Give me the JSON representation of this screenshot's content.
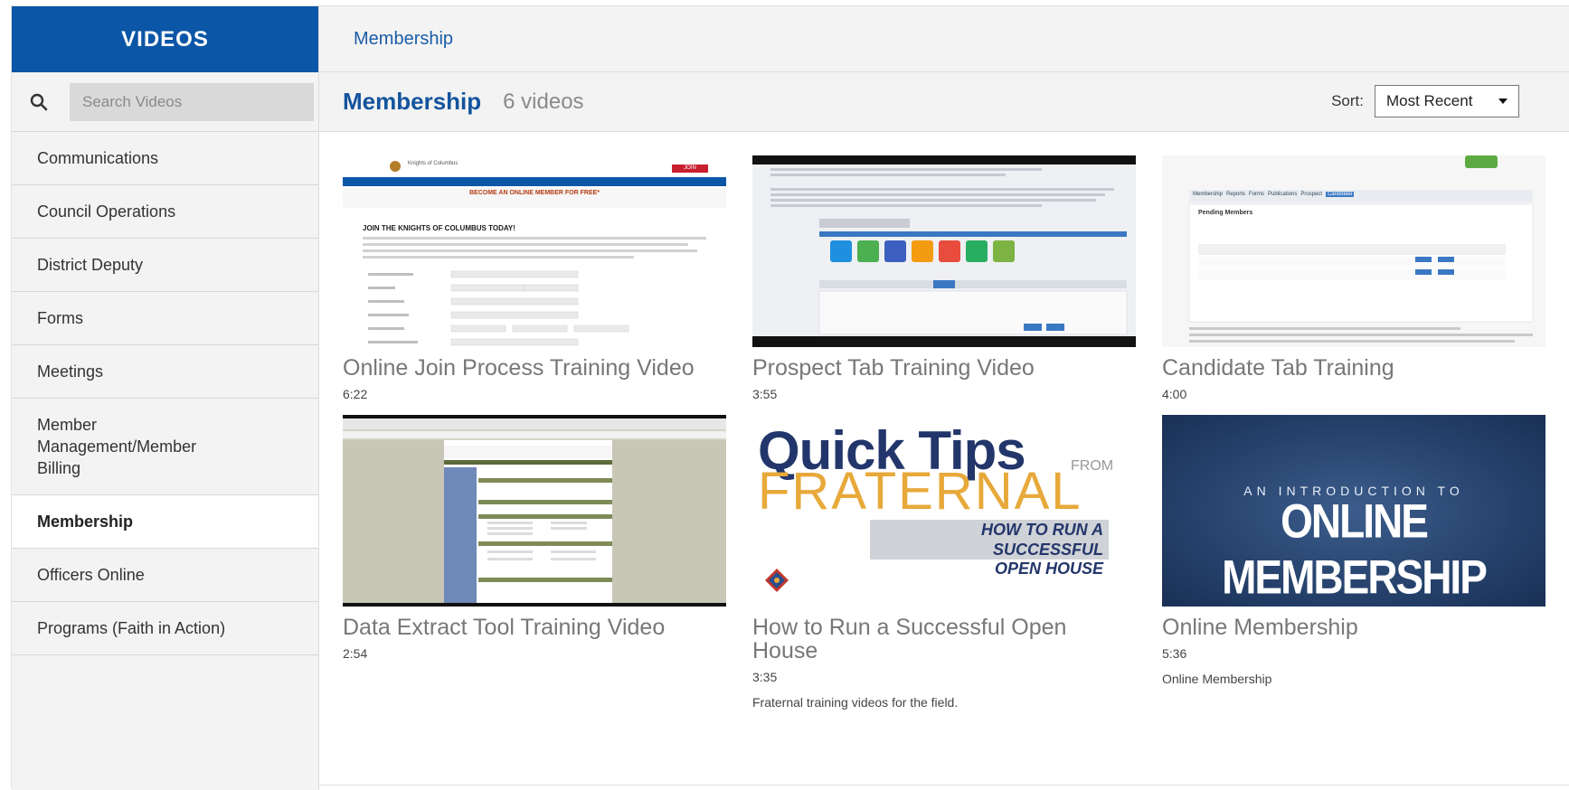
{
  "sidebar": {
    "title": "VIDEOS",
    "search_placeholder": "Search Videos",
    "categories": [
      {
        "label": "Communications"
      },
      {
        "label": "Council Operations"
      },
      {
        "label": "District Deputy"
      },
      {
        "label": "Forms"
      },
      {
        "label": "Meetings"
      },
      {
        "label": "Member Management/Member Billing"
      },
      {
        "label": "Membership"
      },
      {
        "label": "Officers Online"
      },
      {
        "label": "Programs (Faith in Action)"
      }
    ]
  },
  "breadcrumb": "Membership",
  "header": {
    "title": "Membership",
    "count": "6 videos",
    "sort_label": "Sort:",
    "sort_value": "Most Recent"
  },
  "videos": [
    {
      "title": "Online Join Process Training Video",
      "duration": "6:22",
      "thumb": {
        "heading": "JOIN THE KNIGHTS OF COLUMBUS TODAY!",
        "banner": "BECOME AN ONLINE MEMBER FOR FREE*",
        "brand": "Knights of Columbus",
        "join_btn": "JOIN"
      }
    },
    {
      "title": "Prospect Tab Training Video",
      "duration": "3:55"
    },
    {
      "title": "Candidate Tab Training",
      "duration": "4:00",
      "thumb": {
        "tabs": [
          "Membership",
          "Reports",
          "Forms",
          "Publications",
          "Prospect",
          "Candidate"
        ],
        "panel_title": "Pending Members"
      }
    },
    {
      "title": "Data Extract Tool Training Video",
      "duration": "2:54"
    },
    {
      "title": "How to Run a Successful Open House",
      "duration": "3:35",
      "description": "Fraternal training videos for the field.",
      "thumb": {
        "line1": "Quick Tips",
        "from": "FROM",
        "line2": "FRATERNAL",
        "line3": "HOW TO RUN A SUCCESSFUL",
        "line4": "OPEN HOUSE"
      }
    },
    {
      "title": "Online Membership",
      "duration": "5:36",
      "description": "Online Membership",
      "thumb": {
        "kicker": "AN INTRODUCTION TO",
        "headline": "ONLINE MEMBERSHIP"
      }
    }
  ],
  "colors": {
    "brand_blue": "#0b56a6",
    "link_blue": "#1b5da8",
    "gold": "#e7a93a",
    "navy": "#23366b"
  }
}
